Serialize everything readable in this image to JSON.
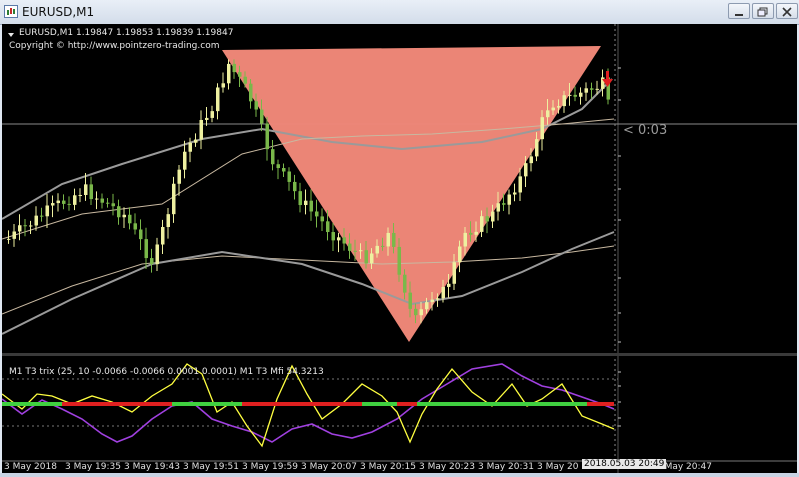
{
  "window": {
    "title": "EURUSD,M1",
    "buttons": [
      "minimize",
      "restore",
      "close"
    ]
  },
  "chart": {
    "info_line": "EURUSD,M1  1.19847 1.19853 1.19839 1.19847",
    "copyright": "Copyright © http://www.pointzero-trading.com",
    "timer": "< 0:03",
    "time_ticks": [
      "3 May 2018",
      "3 May 19:35",
      "3 May 19:43",
      "3 May 19:51",
      "3 May 19:59",
      "3 May 20:07",
      "3 May 20:15",
      "3 May 20:23",
      "3 May 20:31",
      "3 May 20",
      "3 May 20:47"
    ],
    "last_time": "2018.05.03 20:49",
    "colors": {
      "bull": "#eef0a0",
      "bear": "#7ab84a",
      "pattern": "#f08878",
      "ma": "#9a9a9a",
      "ma_light": "#c8b8a0",
      "arrow": "#e02020"
    }
  },
  "subwindow": {
    "label": "M1  T3 trix (25, 10 -0.0066 -0.0066 0.0001 0.0001)  M1  T3 Mfi  54.3213",
    "colors": {
      "mfi": "#ffff40",
      "trix": "#a040e0",
      "signal_up": "#40d040",
      "signal_down": "#e02020"
    }
  },
  "chart_data": {
    "type": "candlestick",
    "series": [
      {
        "name": "EURUSD,M1",
        "last": {
          "open": 1.19847,
          "high": 1.19853,
          "low": 1.19839,
          "close": 1.19847
        }
      }
    ]
  }
}
